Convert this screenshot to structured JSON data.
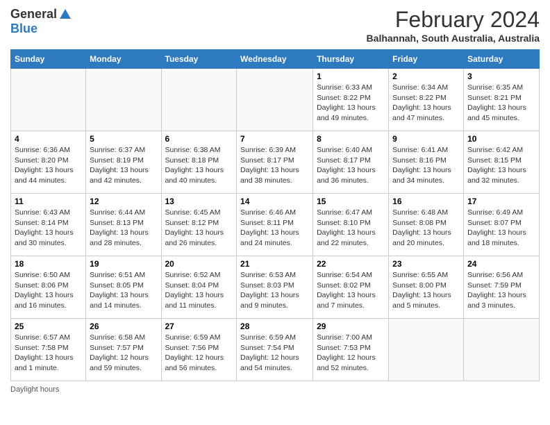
{
  "logo": {
    "general": "General",
    "blue": "Blue",
    "tagline": "GeneralBlue"
  },
  "title": {
    "month_year": "February 2024",
    "location": "Balhannah, South Australia, Australia"
  },
  "days_of_week": [
    "Sunday",
    "Monday",
    "Tuesday",
    "Wednesday",
    "Thursday",
    "Friday",
    "Saturday"
  ],
  "weeks": [
    [
      {
        "day": "",
        "info": ""
      },
      {
        "day": "",
        "info": ""
      },
      {
        "day": "",
        "info": ""
      },
      {
        "day": "",
        "info": ""
      },
      {
        "day": "1",
        "info": "Sunrise: 6:33 AM\nSunset: 8:22 PM\nDaylight: 13 hours and 49 minutes."
      },
      {
        "day": "2",
        "info": "Sunrise: 6:34 AM\nSunset: 8:22 PM\nDaylight: 13 hours and 47 minutes."
      },
      {
        "day": "3",
        "info": "Sunrise: 6:35 AM\nSunset: 8:21 PM\nDaylight: 13 hours and 45 minutes."
      }
    ],
    [
      {
        "day": "4",
        "info": "Sunrise: 6:36 AM\nSunset: 8:20 PM\nDaylight: 13 hours and 44 minutes."
      },
      {
        "day": "5",
        "info": "Sunrise: 6:37 AM\nSunset: 8:19 PM\nDaylight: 13 hours and 42 minutes."
      },
      {
        "day": "6",
        "info": "Sunrise: 6:38 AM\nSunset: 8:18 PM\nDaylight: 13 hours and 40 minutes."
      },
      {
        "day": "7",
        "info": "Sunrise: 6:39 AM\nSunset: 8:17 PM\nDaylight: 13 hours and 38 minutes."
      },
      {
        "day": "8",
        "info": "Sunrise: 6:40 AM\nSunset: 8:17 PM\nDaylight: 13 hours and 36 minutes."
      },
      {
        "day": "9",
        "info": "Sunrise: 6:41 AM\nSunset: 8:16 PM\nDaylight: 13 hours and 34 minutes."
      },
      {
        "day": "10",
        "info": "Sunrise: 6:42 AM\nSunset: 8:15 PM\nDaylight: 13 hours and 32 minutes."
      }
    ],
    [
      {
        "day": "11",
        "info": "Sunrise: 6:43 AM\nSunset: 8:14 PM\nDaylight: 13 hours and 30 minutes."
      },
      {
        "day": "12",
        "info": "Sunrise: 6:44 AM\nSunset: 8:13 PM\nDaylight: 13 hours and 28 minutes."
      },
      {
        "day": "13",
        "info": "Sunrise: 6:45 AM\nSunset: 8:12 PM\nDaylight: 13 hours and 26 minutes."
      },
      {
        "day": "14",
        "info": "Sunrise: 6:46 AM\nSunset: 8:11 PM\nDaylight: 13 hours and 24 minutes."
      },
      {
        "day": "15",
        "info": "Sunrise: 6:47 AM\nSunset: 8:10 PM\nDaylight: 13 hours and 22 minutes."
      },
      {
        "day": "16",
        "info": "Sunrise: 6:48 AM\nSunset: 8:08 PM\nDaylight: 13 hours and 20 minutes."
      },
      {
        "day": "17",
        "info": "Sunrise: 6:49 AM\nSunset: 8:07 PM\nDaylight: 13 hours and 18 minutes."
      }
    ],
    [
      {
        "day": "18",
        "info": "Sunrise: 6:50 AM\nSunset: 8:06 PM\nDaylight: 13 hours and 16 minutes."
      },
      {
        "day": "19",
        "info": "Sunrise: 6:51 AM\nSunset: 8:05 PM\nDaylight: 13 hours and 14 minutes."
      },
      {
        "day": "20",
        "info": "Sunrise: 6:52 AM\nSunset: 8:04 PM\nDaylight: 13 hours and 11 minutes."
      },
      {
        "day": "21",
        "info": "Sunrise: 6:53 AM\nSunset: 8:03 PM\nDaylight: 13 hours and 9 minutes."
      },
      {
        "day": "22",
        "info": "Sunrise: 6:54 AM\nSunset: 8:02 PM\nDaylight: 13 hours and 7 minutes."
      },
      {
        "day": "23",
        "info": "Sunrise: 6:55 AM\nSunset: 8:00 PM\nDaylight: 13 hours and 5 minutes."
      },
      {
        "day": "24",
        "info": "Sunrise: 6:56 AM\nSunset: 7:59 PM\nDaylight: 13 hours and 3 minutes."
      }
    ],
    [
      {
        "day": "25",
        "info": "Sunrise: 6:57 AM\nSunset: 7:58 PM\nDaylight: 13 hours and 1 minute."
      },
      {
        "day": "26",
        "info": "Sunrise: 6:58 AM\nSunset: 7:57 PM\nDaylight: 12 hours and 59 minutes."
      },
      {
        "day": "27",
        "info": "Sunrise: 6:59 AM\nSunset: 7:56 PM\nDaylight: 12 hours and 56 minutes."
      },
      {
        "day": "28",
        "info": "Sunrise: 6:59 AM\nSunset: 7:54 PM\nDaylight: 12 hours and 54 minutes."
      },
      {
        "day": "29",
        "info": "Sunrise: 7:00 AM\nSunset: 7:53 PM\nDaylight: 12 hours and 52 minutes."
      },
      {
        "day": "",
        "info": ""
      },
      {
        "day": "",
        "info": ""
      }
    ]
  ],
  "footer": {
    "daylight_label": "Daylight hours"
  }
}
